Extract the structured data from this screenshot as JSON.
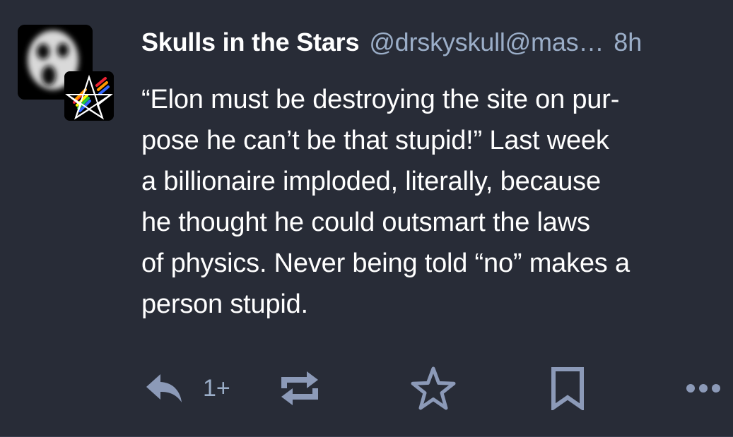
{
  "post": {
    "author": {
      "display_name": "Skulls in the Stars",
      "handle": "@drskyskull@mas…",
      "avatar_icon": "ghost-face-icon",
      "booster_avatar_icon": "rainbow-pentagram-icon"
    },
    "timestamp": "8h",
    "content_lines": [
      "“Elon must be destroying the site on pur-",
      "pose he can’t be that stupid!” Last week",
      "a billionaire imploded, literally, because",
      "he thought he could outsmart the laws",
      "of physics. Never being told “no” makes a",
      "person stupid."
    ],
    "actions": {
      "reply_icon": "reply-icon",
      "reply_count": "1+",
      "boost_icon": "boost-icon",
      "favourite_icon": "star-icon",
      "bookmark_icon": "bookmark-icon",
      "more_icon": "more-icon"
    }
  },
  "colors": {
    "background": "#282c37",
    "text": "#ffffff",
    "secondary": "#9baec8",
    "icon": "#8c9ab8"
  }
}
